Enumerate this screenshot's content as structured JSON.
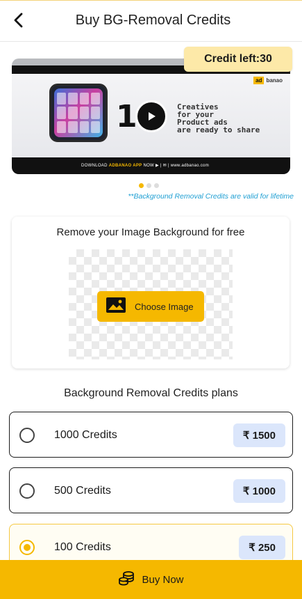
{
  "header": {
    "title": "Buy BG-Removal Credits",
    "back_icon": "back-arrow-icon"
  },
  "banner": {
    "credit_badge": "Credit left:30",
    "brand_part1": "ad",
    "brand_part2": "banao",
    "big_number": "1",
    "promo_line1": "Creatives",
    "promo_line2": "for your",
    "promo_line3": "Product ads",
    "promo_line4": "are ready to share",
    "footer_download": "DOWNLOAD",
    "footer_brand": "ADBANAO APP",
    "footer_rest": "NOW ▶ | ✉ | www.adbanao.com",
    "carousel_pages": 3,
    "carousel_active": 0
  },
  "validity_note": "**Background Removal Credits are valid for lifetime",
  "upload_card": {
    "title": "Remove your Image Background for free",
    "button_label": "Choose Image"
  },
  "plans": {
    "title": "Background Removal Credits plans",
    "items": [
      {
        "name": "1000 Credits",
        "price": "₹ 1500",
        "selected": false
      },
      {
        "name": "500 Credits",
        "price": "₹ 1000",
        "selected": false
      },
      {
        "name": "100 Credits",
        "price": "₹ 250",
        "selected": true
      }
    ]
  },
  "buy": {
    "label": "Buy Now"
  },
  "colors": {
    "accent": "#f5b800",
    "price_bg": "#dbe6fb",
    "badge_bg": "#fde9a8",
    "note": "#1f9fd3"
  }
}
